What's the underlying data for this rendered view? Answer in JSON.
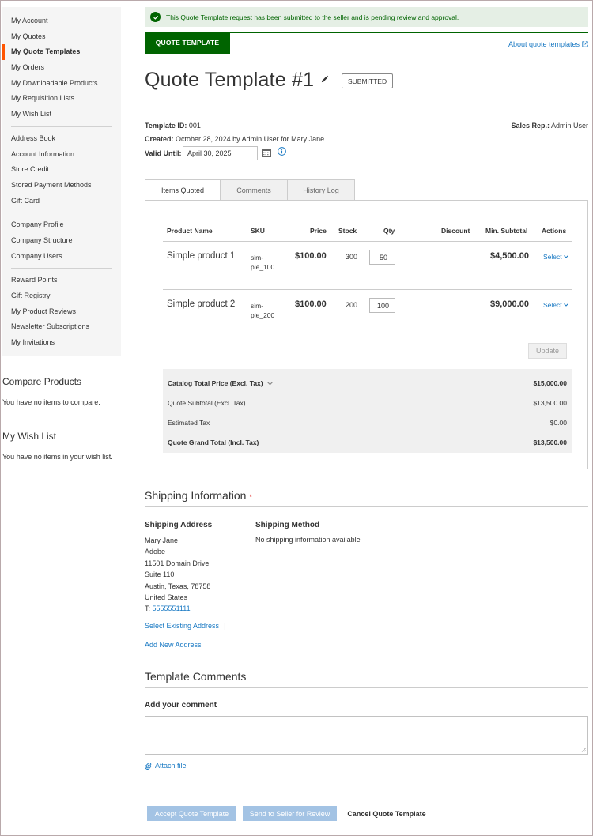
{
  "sidebar": {
    "groups": [
      [
        "My Account",
        "My Quotes",
        "My Quote Templates",
        "My Orders",
        "My Downloadable Products",
        "My Requisition Lists",
        "My Wish List"
      ],
      [
        "Address Book",
        "Account Information",
        "Store Credit",
        "Stored Payment Methods",
        "Gift Card"
      ],
      [
        "Company Profile",
        "Company Structure",
        "Company Users"
      ],
      [
        "Reward Points",
        "Gift Registry",
        "My Product Reviews",
        "Newsletter Subscriptions",
        "My Invitations"
      ]
    ],
    "active": "My Quote Templates"
  },
  "compare": {
    "title": "Compare Products",
    "text": "You have no items to compare."
  },
  "wishlist": {
    "title": "My Wish List",
    "text": "You have no items in your wish list."
  },
  "notice": "This Quote Template request has been submitted to the seller and is pending review and approval.",
  "header": {
    "tab_label": "QUOTE TEMPLATE",
    "about_link": "About quote templates",
    "title": "Quote Template #1",
    "status": "SUBMITTED"
  },
  "meta": {
    "template_id_label": "Template ID:",
    "template_id": "001",
    "created_label": "Created:",
    "created": "October 28, 2024 by Admin User for Mary Jane",
    "valid_until_label": "Valid Until:",
    "valid_until": "April 30, 2025",
    "sales_rep_label": "Sales Rep.:",
    "sales_rep": "Admin User"
  },
  "tabs": [
    "Items Quoted",
    "Comments",
    "History Log"
  ],
  "table": {
    "headers": {
      "product": "Product Name",
      "sku": "SKU",
      "price": "Price",
      "stock": "Stock",
      "qty": "Qty",
      "discount": "Discount",
      "min_subtotal": "Min. Subtotal",
      "actions": "Actions"
    },
    "rows": [
      {
        "name": "Simple product 1",
        "sku": "sim-ple_100",
        "sku_lines": [
          "sim-",
          "ple_100"
        ],
        "price": "$100.00",
        "stock": "300",
        "qty": "50",
        "subtotal": "$4,500.00",
        "action": "Select"
      },
      {
        "name": "Simple product 2",
        "sku": "sim-ple_200",
        "sku_lines": [
          "sim-",
          "ple_200"
        ],
        "price": "$100.00",
        "stock": "200",
        "qty": "100",
        "subtotal": "$9,000.00",
        "action": "Select"
      }
    ],
    "update_label": "Update"
  },
  "totals": [
    {
      "label": "Catalog Total Price (Excl. Tax)",
      "value": "$15,000.00",
      "bold": true,
      "expandable": true
    },
    {
      "label": "Quote Subtotal (Excl. Tax)",
      "value": "$13,500.00",
      "bold": false
    },
    {
      "label": "Estimated Tax",
      "value": "$0.00",
      "bold": false
    },
    {
      "label": "Quote Grand Total (Incl. Tax)",
      "value": "$13,500.00",
      "bold": true
    }
  ],
  "shipping": {
    "title": "Shipping Information",
    "address_heading": "Shipping Address",
    "address_lines": [
      "Mary Jane",
      "Adobe",
      "11501 Domain Drive",
      "Suite 110",
      "Austin, Texas, 78758",
      "United States"
    ],
    "phone_prefix": "T:",
    "phone": "5555551111",
    "select_existing": "Select Existing Address",
    "add_new": "Add New Address",
    "method_heading": "Shipping Method",
    "method_text": "No shipping information available"
  },
  "comments": {
    "title": "Template Comments",
    "add_label": "Add your comment",
    "attach": "Attach file"
  },
  "actions": {
    "accept": "Accept Quote Template",
    "send": "Send to Seller for Review",
    "cancel": "Cancel Quote Template"
  },
  "colors": {
    "accent_green": "#006400",
    "link_blue": "#1979c3",
    "active_marker": "#ff5501"
  }
}
